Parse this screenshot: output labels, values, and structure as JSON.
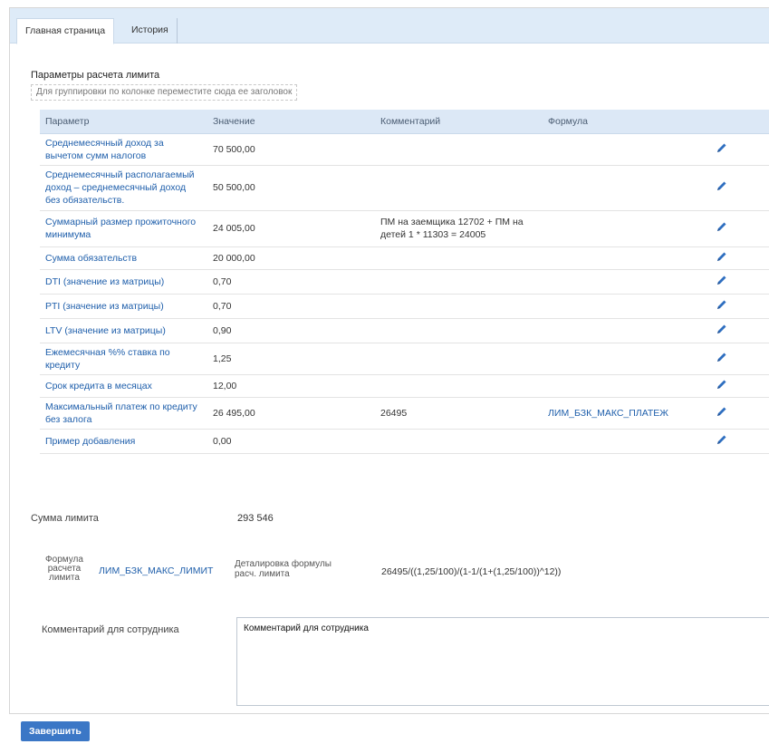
{
  "tabs": [
    {
      "label": "Главная страница",
      "active": true
    },
    {
      "label": "История",
      "active": false
    }
  ],
  "section_title": "Параметры расчета лимита",
  "group_hint": "Для группировки по колонке переместите сюда ее заголовок",
  "table": {
    "headers": {
      "param": "Параметр",
      "value": "Значение",
      "comment": "Комментарий",
      "formula": "Формула"
    },
    "rows": [
      {
        "param": "Среднемесячный доход за вычетом сумм налогов",
        "value": "70 500,00",
        "comment": "",
        "formula": ""
      },
      {
        "param": "Среднемесячный располагаемый доход – среднемесячный доход без обязательств.",
        "value": "50 500,00",
        "comment": "",
        "formula": ""
      },
      {
        "param": "Суммарный размер прожиточного минимума",
        "value": "24 005,00",
        "comment": "ПМ на заемщика 12702 + ПМ на детей 1 * 11303 = 24005",
        "formula": ""
      },
      {
        "param": "Сумма обязательств",
        "value": "20 000,00",
        "comment": "",
        "formula": ""
      },
      {
        "param": "DTI (значение из матрицы)",
        "value": "0,70",
        "comment": "",
        "formula": ""
      },
      {
        "param": "PTI (значение из матрицы)",
        "value": "0,70",
        "comment": "",
        "formula": ""
      },
      {
        "param": "LTV (значение из матрицы)",
        "value": "0,90",
        "comment": "",
        "formula": ""
      },
      {
        "param": "Ежемесячная %% ставка по кредиту",
        "value": "1,25",
        "comment": "",
        "formula": ""
      },
      {
        "param": "Срок кредита в месяцах",
        "value": "12,00",
        "comment": "",
        "formula": ""
      },
      {
        "param": "Максимальный платеж по кредиту без залога",
        "value": "26 495,00",
        "comment": "26495",
        "formula": "ЛИМ_БЗК_МАКС_ПЛАТЕЖ"
      },
      {
        "param": "Пример добавления",
        "value": "0,00",
        "comment": "",
        "formula": ""
      }
    ]
  },
  "summary": {
    "sum_label": "Сумма лимита",
    "sum_value": "293 546",
    "formula_label": "Формула расчета лимита",
    "formula_code": "ЛИМ_БЗК_МАКС_ЛИМИТ",
    "detail_label": "Деталировка формулы расч. лимита",
    "detail_value": "26495/((1,25/100)/(1-1/(1+(1,25/100))^12))"
  },
  "comment": {
    "label": "Комментарий для сотрудника",
    "value": "Комментарий для сотрудника"
  },
  "finish_button": "Завершить",
  "icons": {
    "edit": "pencil-icon"
  },
  "colors": {
    "link": "#1f5fab",
    "header_bg": "#dce8f6",
    "tabbar_bg": "#deebf8",
    "button_bg": "#3b77c6"
  }
}
